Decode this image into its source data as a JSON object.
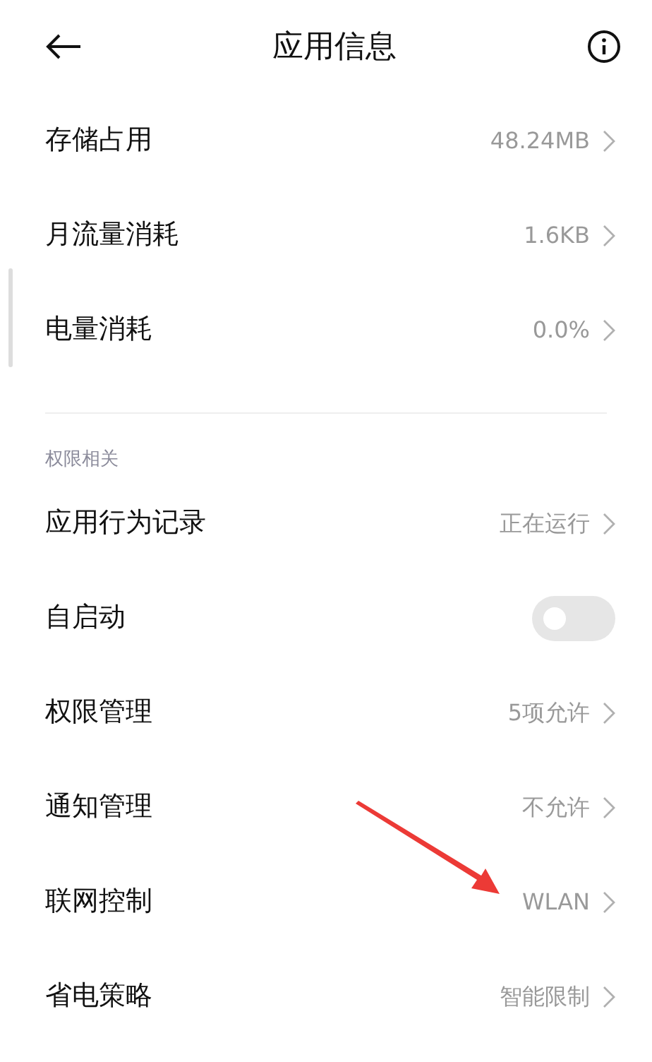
{
  "header": {
    "title": "应用信息"
  },
  "usage_items": [
    {
      "kind": "link",
      "label": "存储占用",
      "value": "48.24MB"
    },
    {
      "kind": "link",
      "label": "月流量消耗",
      "value": "1.6KB"
    },
    {
      "kind": "link",
      "label": "电量消耗",
      "value": "0.0%"
    }
  ],
  "permissions_section": {
    "title": "权限相关",
    "items": [
      {
        "kind": "link",
        "label": "应用行为记录",
        "value": "正在运行"
      },
      {
        "kind": "toggle",
        "label": "自启动",
        "on": false
      },
      {
        "kind": "link",
        "label": "权限管理",
        "value": "5项允许"
      },
      {
        "kind": "link",
        "label": "通知管理",
        "value": "不允许"
      },
      {
        "kind": "link",
        "label": "联网控制",
        "value": "WLAN"
      },
      {
        "kind": "link",
        "label": "省电策略",
        "value": "智能限制"
      }
    ]
  }
}
